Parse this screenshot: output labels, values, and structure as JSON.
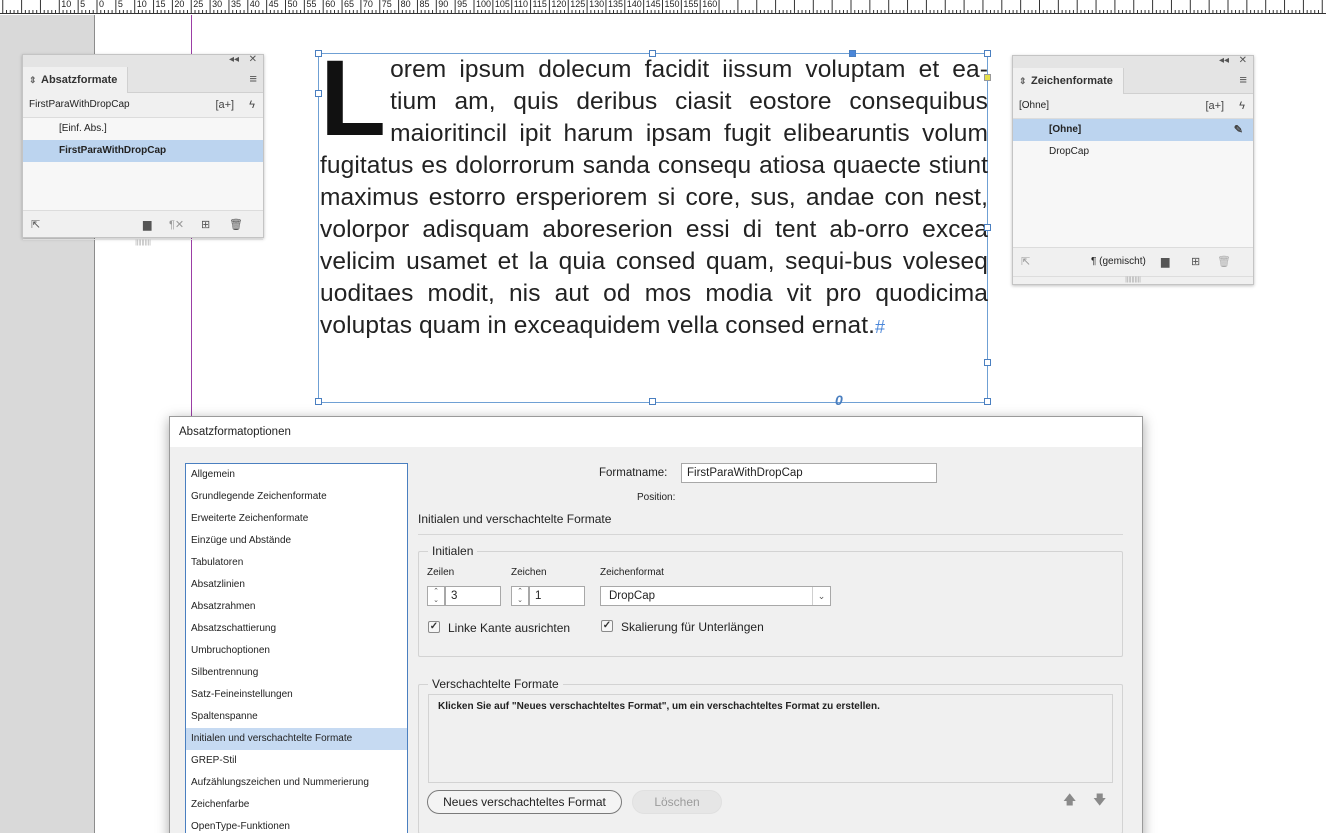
{
  "ruler": {
    "labels": [
      "10",
      "5",
      "0",
      "5",
      "10",
      "15",
      "20",
      "25",
      "30",
      "35",
      "40",
      "45",
      "50",
      "55",
      "60",
      "65",
      "70",
      "75",
      "80",
      "85",
      "90",
      "95",
      "100",
      "105",
      "110",
      "115",
      "120",
      "125",
      "130",
      "135",
      "140",
      "145",
      "150",
      "155",
      "160"
    ]
  },
  "paragraph_panel": {
    "title": "Absatzformate",
    "current_style": "FirstParaWithDropCap",
    "items": [
      {
        "label": "[Einf. Abs.]",
        "selected": false
      },
      {
        "label": "FirstParaWithDropCap",
        "selected": true
      }
    ],
    "icons": {
      "new_from": "a+",
      "lightning": "ϟ"
    }
  },
  "character_panel": {
    "title": "Zeichenformate",
    "current_style": "[Ohne]",
    "items": [
      {
        "label": "[Ohne]",
        "selected": true
      },
      {
        "label": "DropCap",
        "selected": false
      }
    ],
    "bottom_label": "¶ (gemischt)",
    "icons": {
      "new_from": "a+",
      "lightning": "ϟ"
    }
  },
  "text_frame": {
    "drop_cap_letter": "L",
    "body": "orem ipsum dolecum facidit iissum voluptam et ea-tium am, quis deribus ciasit eostore consequibus maioritincil ipit harum ipsam fugit elibearuntis volum fugitatus es dolorrorum sanda consequ atiosa quaecte stiunt maximus estorro ersperiorem si core, sus, andae con nest, volorpor adisquam aboreserion essi di tent ab-orro excea velicim usamet et la quia consed quam, sequi-bus voleseq uoditaes modit, nis aut od mos modia vit pro quodicima voluptas quam in exceaquidem vella consed ernat.",
    "end_mark": "#",
    "overset_mark": "0"
  },
  "dialog": {
    "title": "Absatzformatoptionen",
    "categories": [
      "Allgemein",
      "Grundlegende Zeichenformate",
      "Erweiterte Zeichenformate",
      "Einzüge und Abstände",
      "Tabulatoren",
      "Absatzlinien",
      "Absatzrahmen",
      "Absatzschattierung",
      "Umbruchoptionen",
      "Silbentrennung",
      "Satz-Feineinstellungen",
      "Spaltenspanne",
      "Initialen und verschachtelte Formate",
      "GREP-Stil",
      "Aufzählungszeichen und Nummerierung",
      "Zeichenfarbe",
      "OpenType-Funktionen"
    ],
    "selected_category": 12,
    "format_name_label": "Formatname:",
    "format_name_value": "FirstParaWithDropCap",
    "position_label": "Position:",
    "section_title": "Initialen und verschachtelte Formate",
    "initials": {
      "legend": "Initialen",
      "lines_label": "Zeilen",
      "lines_value": "3",
      "chars_label": "Zeichen",
      "chars_value": "1",
      "charstyle_label": "Zeichenformat",
      "charstyle_value": "DropCap",
      "align_left_label": "Linke Kante ausrichten",
      "align_left_checked": true,
      "scale_label": "Skalierung für Unterlängen",
      "scale_checked": true
    },
    "nested": {
      "legend": "Verschachtelte Formate",
      "hint": "Klicken Sie auf \"Neues verschachteltes Format\", um ein verschachteltes Format zu erstellen.",
      "new_button": "Neues verschachteltes Format",
      "delete_button": "Löschen"
    }
  }
}
